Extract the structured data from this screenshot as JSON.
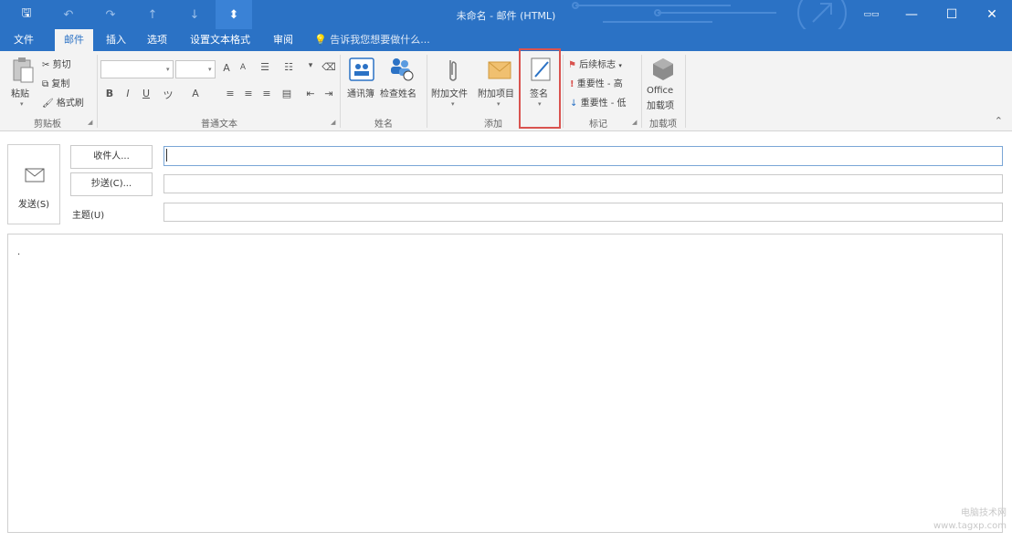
{
  "window": {
    "title": "未命名 - 邮件 (HTML)"
  },
  "quick_access": [
    {
      "icon": "save-icon",
      "glyph": "🖫"
    },
    {
      "icon": "undo-icon",
      "glyph": "↶"
    },
    {
      "icon": "redo-icon",
      "glyph": "↷"
    },
    {
      "icon": "up-arrow-icon",
      "glyph": "↑"
    },
    {
      "icon": "down-arrow-icon",
      "glyph": "↓"
    },
    {
      "icon": "customize-qat-icon",
      "glyph": "⬍"
    }
  ],
  "window_controls": {
    "ribbon_options": "▭▭",
    "minimize": "—",
    "maximize": "☐",
    "close": "✕"
  },
  "tabs": [
    {
      "label": "文件"
    },
    {
      "label": "邮件"
    },
    {
      "label": "插入"
    },
    {
      "label": "选项"
    },
    {
      "label": "设置文本格式"
    },
    {
      "label": "审阅"
    }
  ],
  "tell_me": "告诉我您想要做什么...",
  "ribbon": {
    "clipboard": {
      "paste": "粘贴",
      "cut": "剪切",
      "copy": "复制",
      "format_painter": "格式刷",
      "group": "剪贴板"
    },
    "basic_text": {
      "bold": "B",
      "italic": "I",
      "underline": "U",
      "grow_font": "A",
      "shrink_font": "A",
      "font_color": "A",
      "highlight": "ツ",
      "clear": "A",
      "group": "普通文本"
    },
    "names": {
      "address_book": "通讯簿",
      "check_names": "检查姓名",
      "group": "姓名"
    },
    "include": {
      "attach_file": "附加文件",
      "attach_item": "附加项目",
      "signature": "签名",
      "group": "添加"
    },
    "tags": {
      "follow_up": "后续标志",
      "high_importance": "重要性 - 高",
      "low_importance": "重要性 - 低",
      "group": "标记"
    },
    "addins": {
      "office_line1": "Office",
      "office_line2": "加载项",
      "group": "加载项"
    }
  },
  "compose": {
    "send": "发送(S)",
    "to_button": "收件人...",
    "cc_button": "抄送(C)...",
    "subject_label": "主题(U)",
    "to_value": "",
    "cc_value": "",
    "subject_value": "",
    "body_marker": "."
  },
  "watermark": {
    "line1": "电脑技术网",
    "line2": "www.tagxp.com"
  },
  "colors": {
    "title_bar": "#2b72c5",
    "ribbon_bg": "#f3f3f3",
    "highlight_box": "#d9534f"
  }
}
